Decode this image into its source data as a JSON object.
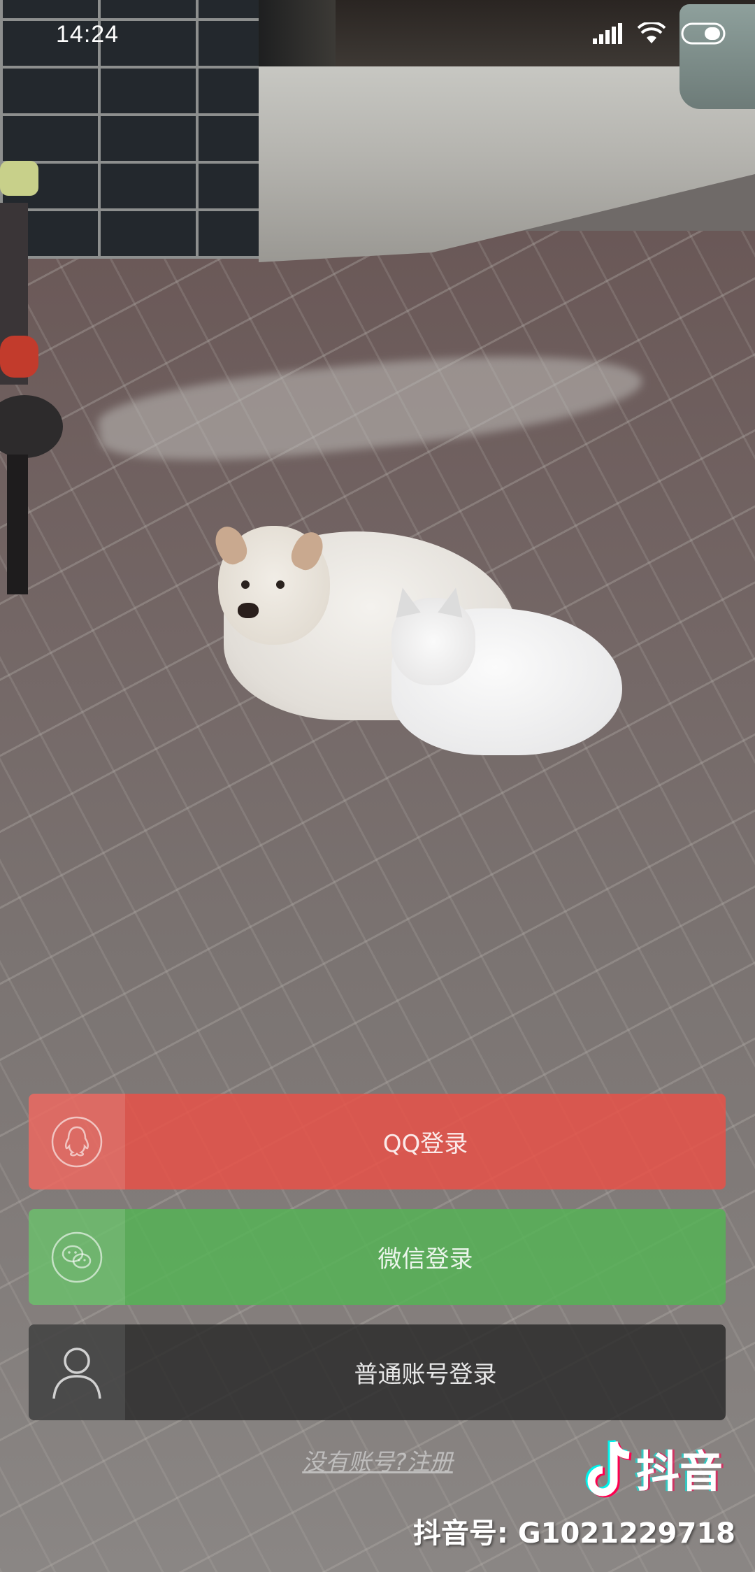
{
  "status_bar": {
    "time": "14:24",
    "icons": [
      "signal-icon",
      "wifi-icon",
      "battery-icon"
    ]
  },
  "login": {
    "qq_label": "QQ登录",
    "wechat_label": "微信登录",
    "account_label": "普通账号登录",
    "register_label": "没有账号?注册",
    "colors": {
      "qq": "#E65248",
      "wechat": "#56B256",
      "account": "#282828"
    }
  },
  "watermark": {
    "app_name": "抖音",
    "account_id": "抖音号: G1021229718"
  }
}
